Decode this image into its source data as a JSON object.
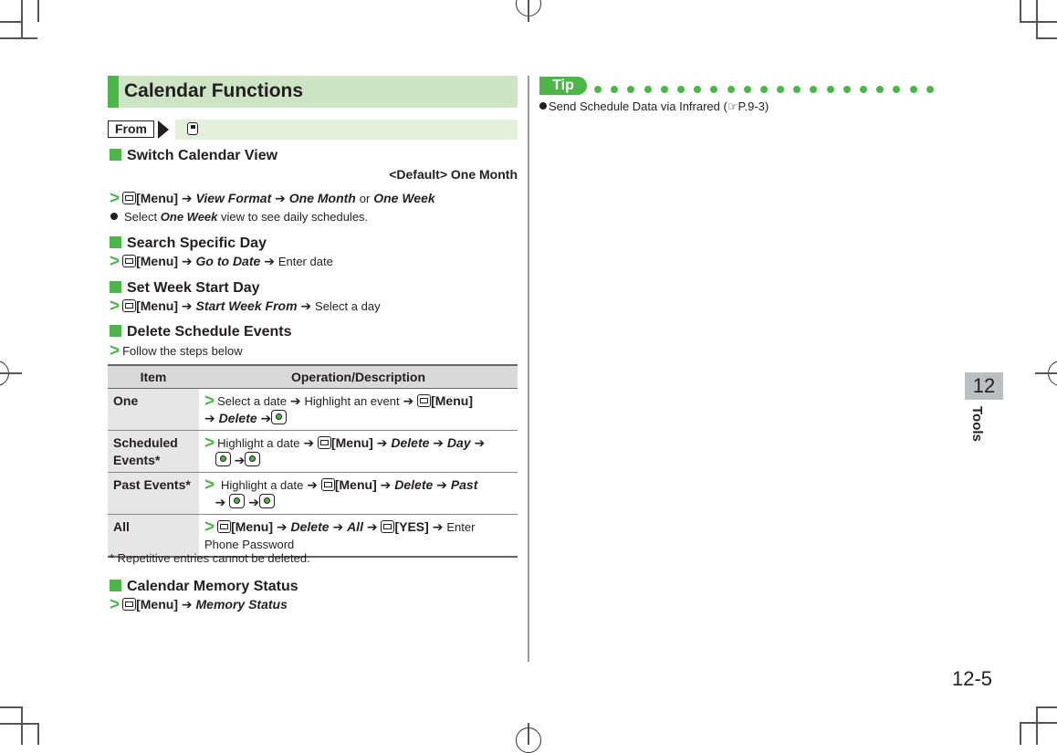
{
  "title": "Calendar Functions",
  "from": {
    "label": "From",
    "key_icon": "navigation-key-icon"
  },
  "sections": [
    {
      "heading": "Switch Calendar View",
      "default_note": "<Default> One Month",
      "step": {
        "key": "[Menu]",
        "p1": "View Format",
        "p2": "One Month",
        "or": "or",
        "p3": "One Week"
      },
      "note": {
        "pre": "Select",
        "em": "One Week",
        "post": "view to see daily schedules."
      }
    },
    {
      "heading": "Search Specific Day",
      "step": {
        "key": "[Menu]",
        "p1": "Go to Date",
        "p2": "Enter date"
      }
    },
    {
      "heading": "Set Week Start Day",
      "step": {
        "key": "[Menu]",
        "p1": "Start Week From",
        "p2": "Select a day"
      }
    },
    {
      "heading": "Delete Schedule Events",
      "step": {
        "text": "Follow the steps below"
      }
    },
    {
      "heading": "Calendar Memory Status",
      "step": {
        "key": "[Menu]",
        "p1": "Memory Status"
      }
    }
  ],
  "table": {
    "headers": [
      "Item",
      "Operation/Description"
    ],
    "rows": [
      {
        "item": "One",
        "t1": "Select a date",
        "t2": "Highlight an event",
        "key": "[Menu]",
        "t3": "Delete"
      },
      {
        "item": "Scheduled Events*",
        "t1": "Highlight a date",
        "key": "[Menu]",
        "t2": "Delete",
        "t3": "Day"
      },
      {
        "item": "Past Events*",
        "t1": "Highlight a date",
        "key": "[Menu]",
        "t2": "Delete",
        "t3": "Past"
      },
      {
        "item": "All",
        "key": "[Menu]",
        "t1": "Delete",
        "t2": "All",
        "key2": "[YES]",
        "t3": "Enter Phone Password"
      }
    ]
  },
  "footnote": "* Repetitive entries cannot be deleted.",
  "tip": {
    "label": "Tip",
    "item": "Send Schedule Data via Infrared (",
    "ref_icon": "pointing-hand-icon",
    "ref": "P.9-3)"
  },
  "chapter": {
    "number": "12",
    "name": "Tools"
  },
  "page_number": "12-5",
  "arrow": "➔"
}
